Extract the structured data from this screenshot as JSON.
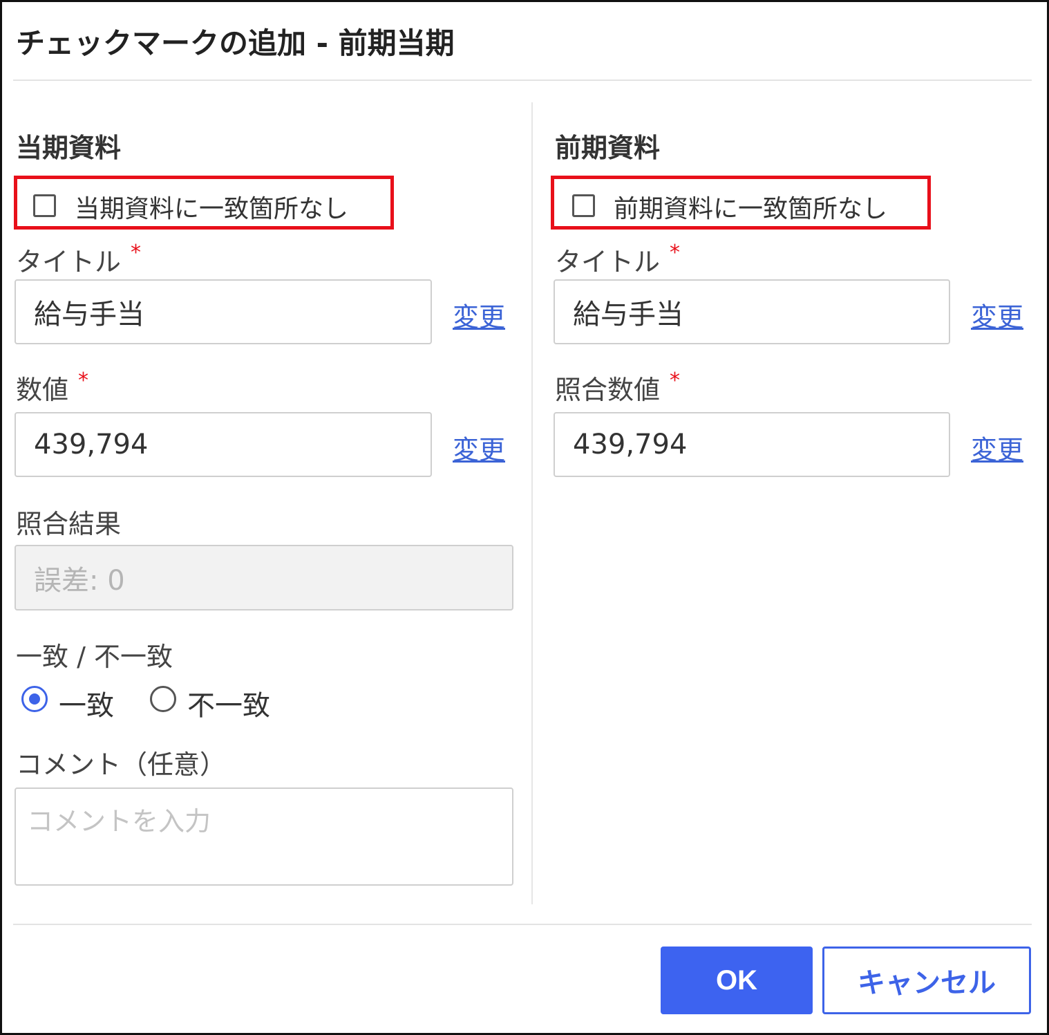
{
  "dialog": {
    "title": "チェックマークの追加 - 前期当期"
  },
  "current": {
    "section_title": "当期資料",
    "no_match_label": "当期資料に一致箇所なし",
    "title_label": "タイトル",
    "title_value": "給与手当",
    "title_change": "変更",
    "value_label": "数値",
    "value_value": "439,794",
    "value_change": "変更",
    "result_label": "照合結果",
    "result_value": "誤差: 0",
    "match_label": "一致 / 不一致",
    "match_option": "一致",
    "mismatch_option": "不一致",
    "comment_label": "コメント（任意）",
    "comment_placeholder": "コメントを入力"
  },
  "previous": {
    "section_title": "前期資料",
    "no_match_label": "前期資料に一致箇所なし",
    "title_label": "タイトル",
    "title_value": "給与手当",
    "title_change": "変更",
    "value_label": "照合数値",
    "value_value": "439,794",
    "value_change": "変更"
  },
  "required_mark": "*",
  "footer": {
    "ok_label": "OK",
    "cancel_label": "キャンセル"
  },
  "colors": {
    "accent": "#3d63f0",
    "highlight": "#e8101a",
    "link": "#3b63d6"
  }
}
